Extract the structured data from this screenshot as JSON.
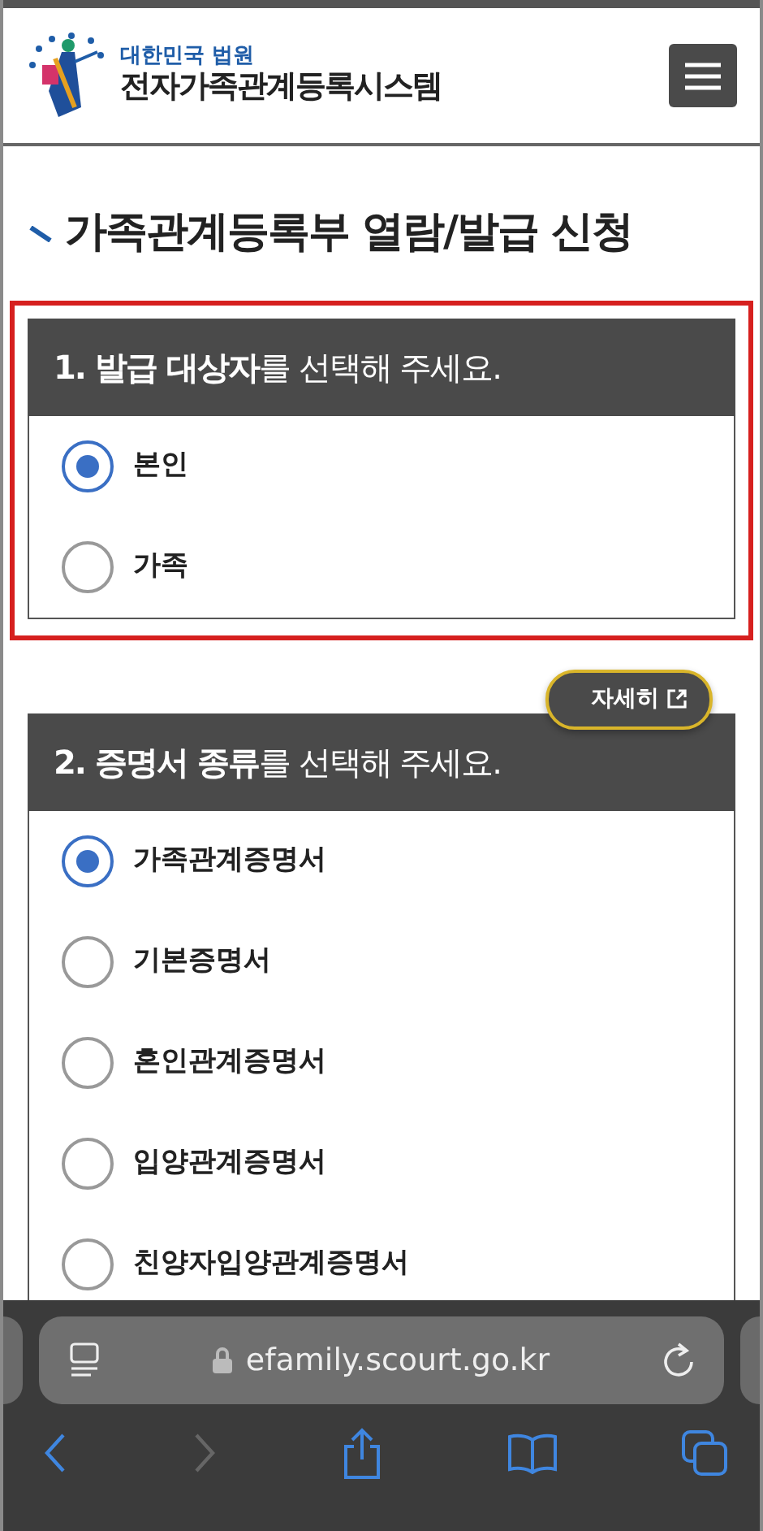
{
  "header": {
    "org": "대한민국 법원",
    "system": "전자가족관계등록시스템"
  },
  "page_title": "가족관계등록부 열람/발급 신청",
  "sections": [
    {
      "heading": "**1. 발급 대상자**를 선택해 주세요.",
      "highlighted": true,
      "options": [
        {
          "label": "본인",
          "selected": true
        },
        {
          "label": "가족",
          "selected": false
        }
      ]
    },
    {
      "heading": "**2. 증명서 종류**를 선택해 주세요.",
      "highlighted": false,
      "detail_button": "자세히",
      "options": [
        {
          "label": "가족관계증명서",
          "selected": true
        },
        {
          "label": "기본증명서",
          "selected": false
        },
        {
          "label": "혼인관계증명서",
          "selected": false
        },
        {
          "label": "입양관계증명서",
          "selected": false
        },
        {
          "label": "친양자입양관계증명서",
          "selected": false
        }
      ]
    }
  ],
  "browser": {
    "url": "efamily.scourt.go.kr",
    "back_disabled": false,
    "forward_disabled": true
  }
}
